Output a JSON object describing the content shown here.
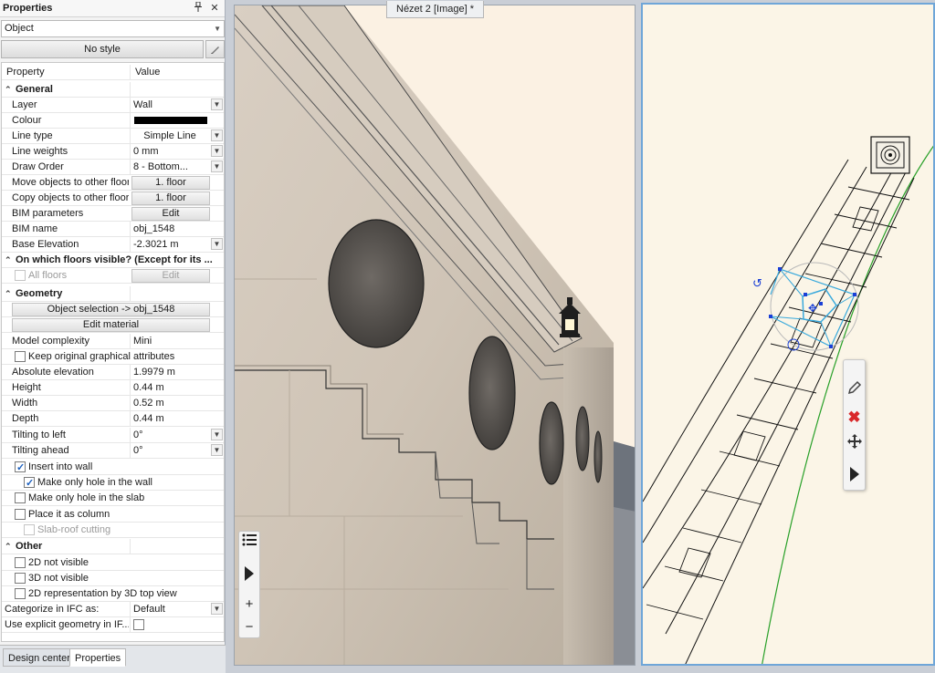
{
  "panel": {
    "title": "Properties",
    "pin_icon": "pin-icon",
    "close_icon": "close-icon",
    "object_select": "Object",
    "style_button": "No style"
  },
  "grid": {
    "header": {
      "property": "Property",
      "value": "Value"
    },
    "general": {
      "title": "General",
      "layer": {
        "label": "Layer",
        "value": "Wall"
      },
      "colour": {
        "label": "Colour",
        "value": "#000000"
      },
      "line_type": {
        "label": "Line type",
        "value": "Simple Line"
      },
      "line_weights": {
        "label": "Line weights",
        "value": "0 mm"
      },
      "draw_order": {
        "label": "Draw Order",
        "value": "8 - Bottom..."
      },
      "move_floor": {
        "label": "Move objects to other floor",
        "value": "1. floor"
      },
      "copy_floor": {
        "label": "Copy objects to other floor",
        "value": "1. floor"
      },
      "bim_params": {
        "label": "BIM parameters",
        "value": "Edit"
      },
      "bim_name": {
        "label": "BIM name",
        "value": "obj_1548"
      },
      "base_elevation": {
        "label": "Base Elevation",
        "value": "-2.3021 m"
      }
    },
    "floors": {
      "title": "On which floors visible? (Except for its ...",
      "all_floors": {
        "label": "All floors",
        "value": "Edit"
      }
    },
    "geometry": {
      "title": "Geometry",
      "object_selection": "Object selection -> obj_1548",
      "edit_material": "Edit material",
      "model_complexity": {
        "label": "Model complexity",
        "value": "Mini"
      },
      "keep_original": "Keep original graphical attributes",
      "abs_elevation": {
        "label": "Absolute elevation",
        "value": "1.9979 m"
      },
      "height": {
        "label": "Height",
        "value": "0.44 m"
      },
      "width": {
        "label": "Width",
        "value": "0.52 m"
      },
      "depth": {
        "label": "Depth",
        "value": "0.44 m"
      },
      "tilt_left": {
        "label": "Tilting to left",
        "value": "0°"
      },
      "tilt_ahead": {
        "label": "Tilting ahead",
        "value": "0°"
      },
      "insert_wall": "Insert into wall",
      "hole_wall": "Make only hole in the wall",
      "hole_slab": "Make only hole in the slab",
      "place_column": "Place it as column",
      "slab_roof": "Slab-roof cutting"
    },
    "other": {
      "title": "Other",
      "not_2d": "2D not visible",
      "not_3d": "3D not visible",
      "rep_3d": "2D representation by 3D top view",
      "ifc": {
        "label": "Categorize in IFC as:",
        "value": "Default"
      },
      "explicit": {
        "label": "Use explicit geometry in IF..."
      }
    }
  },
  "tabs": [
    "Design center",
    "Properties"
  ],
  "viewport_left": {
    "tab_title": "Nézet 2 [Image] *"
  },
  "nav_toolbar": [
    "list-icon",
    "play-icon",
    "zoom-in-icon",
    "zoom-out-icon"
  ],
  "context_toolbar": [
    "pencil-icon",
    "delete-icon",
    "move-icon",
    "play-icon"
  ],
  "colors": {
    "accent": "#6fa6d8",
    "delete": "#d9282a",
    "grip": "#1a3fd6",
    "selection": "#39a9dc",
    "green_line": "#28a028"
  }
}
